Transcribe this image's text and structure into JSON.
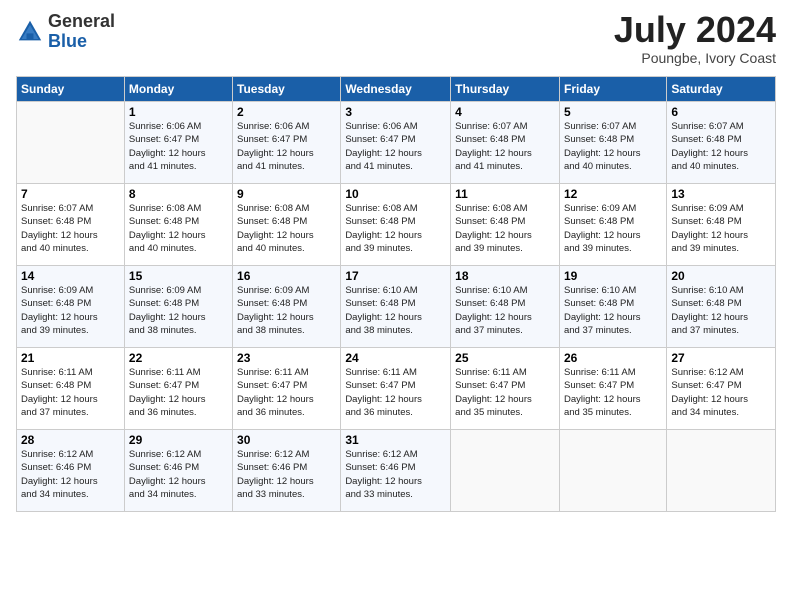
{
  "logo": {
    "general": "General",
    "blue": "Blue"
  },
  "title": "July 2024",
  "location": "Poungbe, Ivory Coast",
  "days_header": [
    "Sunday",
    "Monday",
    "Tuesday",
    "Wednesday",
    "Thursday",
    "Friday",
    "Saturday"
  ],
  "weeks": [
    [
      {
        "day": "",
        "info": ""
      },
      {
        "day": "1",
        "info": "Sunrise: 6:06 AM\nSunset: 6:47 PM\nDaylight: 12 hours\nand 41 minutes."
      },
      {
        "day": "2",
        "info": "Sunrise: 6:06 AM\nSunset: 6:47 PM\nDaylight: 12 hours\nand 41 minutes."
      },
      {
        "day": "3",
        "info": "Sunrise: 6:06 AM\nSunset: 6:47 PM\nDaylight: 12 hours\nand 41 minutes."
      },
      {
        "day": "4",
        "info": "Sunrise: 6:07 AM\nSunset: 6:48 PM\nDaylight: 12 hours\nand 41 minutes."
      },
      {
        "day": "5",
        "info": "Sunrise: 6:07 AM\nSunset: 6:48 PM\nDaylight: 12 hours\nand 40 minutes."
      },
      {
        "day": "6",
        "info": "Sunrise: 6:07 AM\nSunset: 6:48 PM\nDaylight: 12 hours\nand 40 minutes."
      }
    ],
    [
      {
        "day": "7",
        "info": "Sunrise: 6:07 AM\nSunset: 6:48 PM\nDaylight: 12 hours\nand 40 minutes."
      },
      {
        "day": "8",
        "info": "Sunrise: 6:08 AM\nSunset: 6:48 PM\nDaylight: 12 hours\nand 40 minutes."
      },
      {
        "day": "9",
        "info": "Sunrise: 6:08 AM\nSunset: 6:48 PM\nDaylight: 12 hours\nand 40 minutes."
      },
      {
        "day": "10",
        "info": "Sunrise: 6:08 AM\nSunset: 6:48 PM\nDaylight: 12 hours\nand 39 minutes."
      },
      {
        "day": "11",
        "info": "Sunrise: 6:08 AM\nSunset: 6:48 PM\nDaylight: 12 hours\nand 39 minutes."
      },
      {
        "day": "12",
        "info": "Sunrise: 6:09 AM\nSunset: 6:48 PM\nDaylight: 12 hours\nand 39 minutes."
      },
      {
        "day": "13",
        "info": "Sunrise: 6:09 AM\nSunset: 6:48 PM\nDaylight: 12 hours\nand 39 minutes."
      }
    ],
    [
      {
        "day": "14",
        "info": "Sunrise: 6:09 AM\nSunset: 6:48 PM\nDaylight: 12 hours\nand 39 minutes."
      },
      {
        "day": "15",
        "info": "Sunrise: 6:09 AM\nSunset: 6:48 PM\nDaylight: 12 hours\nand 38 minutes."
      },
      {
        "day": "16",
        "info": "Sunrise: 6:09 AM\nSunset: 6:48 PM\nDaylight: 12 hours\nand 38 minutes."
      },
      {
        "day": "17",
        "info": "Sunrise: 6:10 AM\nSunset: 6:48 PM\nDaylight: 12 hours\nand 38 minutes."
      },
      {
        "day": "18",
        "info": "Sunrise: 6:10 AM\nSunset: 6:48 PM\nDaylight: 12 hours\nand 37 minutes."
      },
      {
        "day": "19",
        "info": "Sunrise: 6:10 AM\nSunset: 6:48 PM\nDaylight: 12 hours\nand 37 minutes."
      },
      {
        "day": "20",
        "info": "Sunrise: 6:10 AM\nSunset: 6:48 PM\nDaylight: 12 hours\nand 37 minutes."
      }
    ],
    [
      {
        "day": "21",
        "info": "Sunrise: 6:11 AM\nSunset: 6:48 PM\nDaylight: 12 hours\nand 37 minutes."
      },
      {
        "day": "22",
        "info": "Sunrise: 6:11 AM\nSunset: 6:47 PM\nDaylight: 12 hours\nand 36 minutes."
      },
      {
        "day": "23",
        "info": "Sunrise: 6:11 AM\nSunset: 6:47 PM\nDaylight: 12 hours\nand 36 minutes."
      },
      {
        "day": "24",
        "info": "Sunrise: 6:11 AM\nSunset: 6:47 PM\nDaylight: 12 hours\nand 36 minutes."
      },
      {
        "day": "25",
        "info": "Sunrise: 6:11 AM\nSunset: 6:47 PM\nDaylight: 12 hours\nand 35 minutes."
      },
      {
        "day": "26",
        "info": "Sunrise: 6:11 AM\nSunset: 6:47 PM\nDaylight: 12 hours\nand 35 minutes."
      },
      {
        "day": "27",
        "info": "Sunrise: 6:12 AM\nSunset: 6:47 PM\nDaylight: 12 hours\nand 34 minutes."
      }
    ],
    [
      {
        "day": "28",
        "info": "Sunrise: 6:12 AM\nSunset: 6:46 PM\nDaylight: 12 hours\nand 34 minutes."
      },
      {
        "day": "29",
        "info": "Sunrise: 6:12 AM\nSunset: 6:46 PM\nDaylight: 12 hours\nand 34 minutes."
      },
      {
        "day": "30",
        "info": "Sunrise: 6:12 AM\nSunset: 6:46 PM\nDaylight: 12 hours\nand 33 minutes."
      },
      {
        "day": "31",
        "info": "Sunrise: 6:12 AM\nSunset: 6:46 PM\nDaylight: 12 hours\nand 33 minutes."
      },
      {
        "day": "",
        "info": ""
      },
      {
        "day": "",
        "info": ""
      },
      {
        "day": "",
        "info": ""
      }
    ]
  ]
}
